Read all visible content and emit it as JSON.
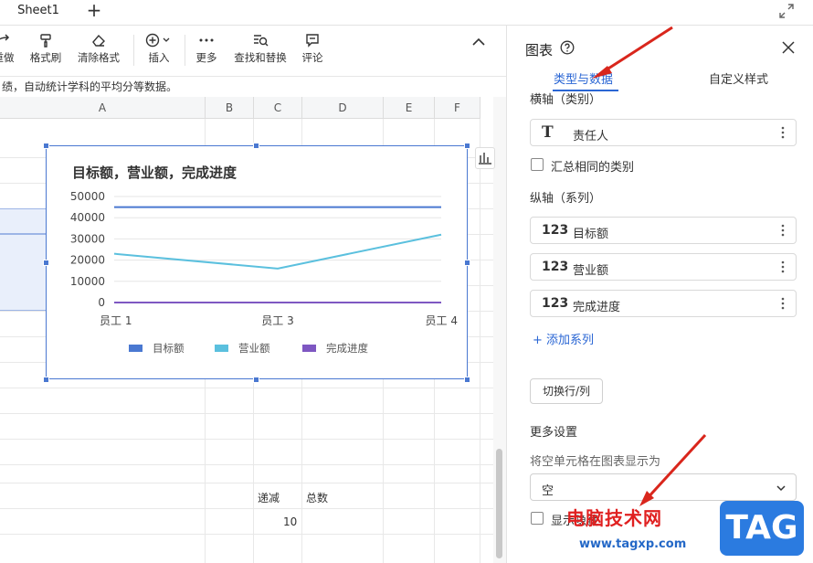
{
  "topbar": {
    "sheet_tab": "Sheet1",
    "add_label": "+"
  },
  "toolbar": {
    "items": [
      {
        "label": "重做",
        "icon": "redo-icon"
      },
      {
        "label": "格式刷",
        "icon": "format-painter-icon"
      },
      {
        "label": "清除格式",
        "icon": "eraser-icon"
      },
      {
        "label": "插入",
        "icon": "insert-plus-icon"
      },
      {
        "label": "更多",
        "icon": "more-dots-icon"
      },
      {
        "label": "查找和替换",
        "icon": "find-replace-icon"
      },
      {
        "label": "评论",
        "icon": "comment-icon"
      }
    ]
  },
  "info_text": "绩，自动统计学科的平均分等数据。",
  "grid": {
    "columns": [
      "A",
      "B",
      "C",
      "D",
      "E",
      "F"
    ],
    "cells": {
      "c_label_1": "递减",
      "d_label_1": "总数",
      "c_value_1": "10"
    }
  },
  "chart_data": {
    "type": "line",
    "title": "目标额，营业额，完成进度",
    "categories": [
      "员工 1",
      "员工 3",
      "员工 4"
    ],
    "ylim": [
      0,
      50000
    ],
    "yticks": [
      0,
      10000,
      20000,
      30000,
      40000,
      50000
    ],
    "ytick_labels": [
      "0",
      "10000",
      "20000",
      "30000",
      "40000",
      "50000"
    ],
    "grid": true,
    "legend_position": "bottom",
    "series": [
      {
        "name": "目标额",
        "values": [
          45000,
          45000,
          45000
        ],
        "color": "#4a78d1"
      },
      {
        "name": "营业额",
        "values": [
          23000,
          16000,
          32000
        ],
        "color": "#5bc0de"
      },
      {
        "name": "完成进度",
        "values": [
          0,
          0,
          0
        ],
        "color": "#7e57c2"
      }
    ]
  },
  "panel": {
    "title": "图表",
    "tabs": [
      {
        "label": "类型与数据",
        "active": true
      },
      {
        "label": "自定义样式",
        "active": false
      }
    ],
    "x_axis_label": "横轴（类别）",
    "x_axis_field": {
      "icon": "T",
      "text": "责任人"
    },
    "merge_same_label": "汇总相同的类别",
    "y_axis_label": "纵轴（系列）",
    "series_fields": [
      {
        "icon": "123",
        "text": "目标额"
      },
      {
        "icon": "123",
        "text": "营业额"
      },
      {
        "icon": "123",
        "text": "完成进度"
      }
    ],
    "add_series": "+ 添加系列",
    "switch_button": "切换行/列",
    "more_settings": "更多设置",
    "empty_cells_label": "将空单元格在图表显示为",
    "empty_cells_value": "空",
    "show_hidden_label": "显示隐藏"
  },
  "watermark": {
    "text": "电脑技术网",
    "url": "www.tagxp.com",
    "logo": "TAG"
  }
}
